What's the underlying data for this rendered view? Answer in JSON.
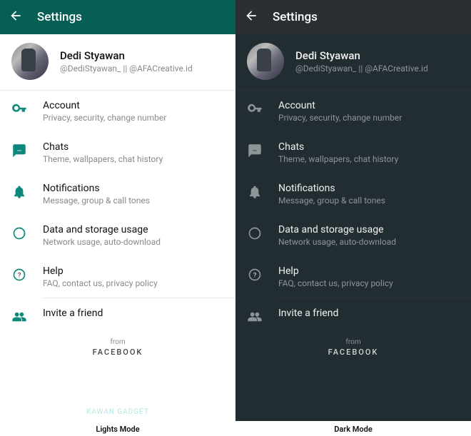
{
  "header": {
    "title": "Settings"
  },
  "profile": {
    "name": "Dedi Styawan",
    "status": "@DediStyawan_ || @AFACreative.id"
  },
  "items": [
    {
      "title": "Account",
      "sub": "Privacy, security, change number"
    },
    {
      "title": "Chats",
      "sub": "Theme, wallpapers, chat history"
    },
    {
      "title": "Notifications",
      "sub": "Message, group & call tones"
    },
    {
      "title": "Data and storage usage",
      "sub": "Network usage, auto-download"
    },
    {
      "title": "Help",
      "sub": "FAQ, contact us, privacy policy"
    },
    {
      "title": "Invite a friend"
    }
  ],
  "footer": {
    "from": "from",
    "brand": "FACEBOOK"
  },
  "modes": {
    "light": "Lights Mode",
    "dark": "Dark Mode"
  },
  "watermark": "KAWAN GADGET"
}
